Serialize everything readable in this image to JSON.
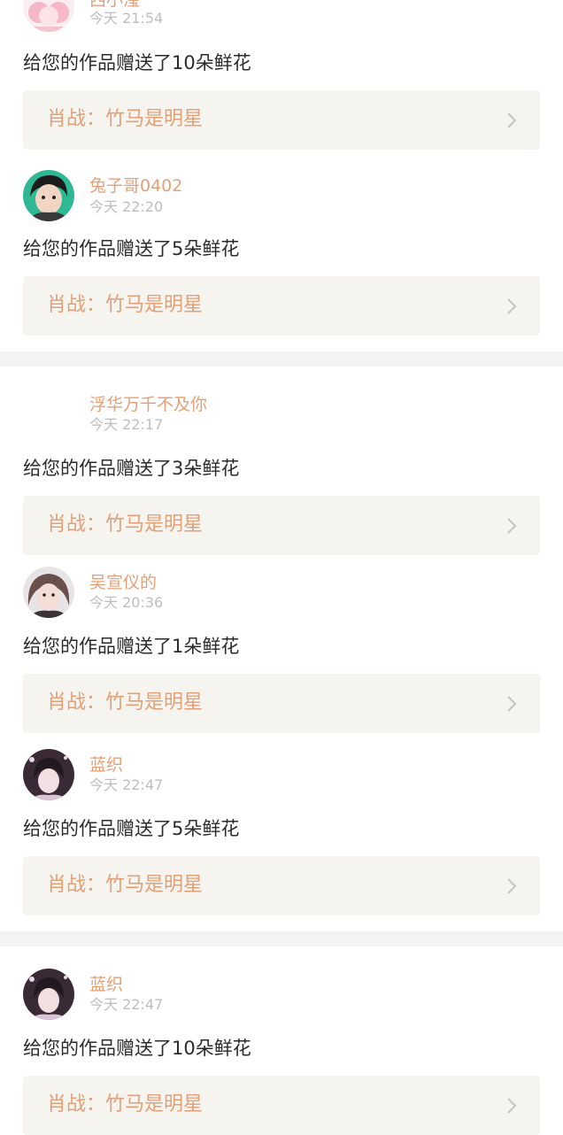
{
  "colors": {
    "accent": "#E3A077",
    "card_bg": "#F5F4EF",
    "time": "#BDBDBD",
    "text": "#2b2b2b",
    "separator": "#F3F3F3"
  },
  "entries": [
    {
      "user": "西小瀅",
      "time": "今天 21:54",
      "message": "给您的作品赠送了10朵鲜花",
      "work": "肖战：竹马是明星",
      "avatar": "pink-hair-anime-avatar"
    },
    {
      "user": "兔子哥0402",
      "time": "今天 22:20",
      "message": "给您的作品赠送了5朵鲜花",
      "work": "肖战：竹马是明星",
      "avatar": "man-photo-avatar"
    },
    {
      "user": "浮华万千不及你",
      "time": "今天 22:17",
      "message": "给您的作品赠送了3朵鲜花",
      "work": "肖战：竹马是明星",
      "avatar": "blank-avatar"
    },
    {
      "user": "吴宣仪的",
      "time": "今天 20:36",
      "message": "给您的作品赠送了1朵鲜花",
      "work": "肖战：竹马是明星",
      "avatar": "woman-photo-avatar"
    },
    {
      "user": "蓝织",
      "time": "今天 22:47",
      "message": "给您的作品赠送了5朵鲜花",
      "work": "肖战：竹马是明星",
      "avatar": "dark-photo-avatar"
    },
    {
      "user": "蓝织",
      "time": "今天 22:47",
      "message": "给您的作品赠送了10朵鲜花",
      "work": "肖战：竹马是明星",
      "avatar": "dark-photo-avatar"
    }
  ]
}
